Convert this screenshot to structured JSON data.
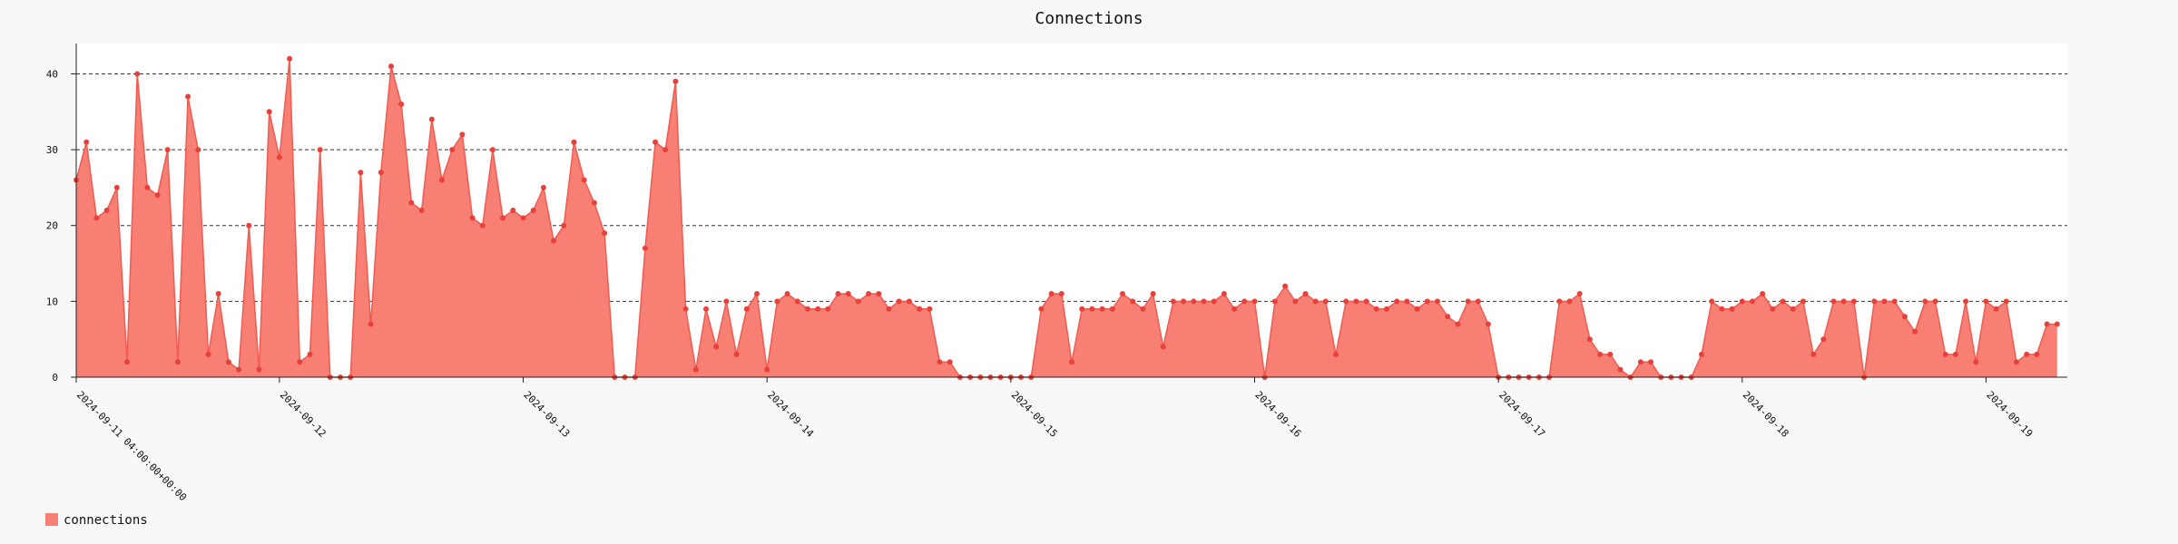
{
  "chart_data": {
    "type": "area",
    "title": "Connections",
    "xlabel": "",
    "ylabel": "",
    "ylim": [
      0,
      44
    ],
    "y_ticks": [
      0,
      10,
      20,
      30,
      40
    ],
    "grid": "horizontal dashed",
    "legend_position": "bottom-left",
    "colors": {
      "fill": "#f77f74",
      "line": "#f15b51",
      "point": "#e8403a",
      "grid": "#333333"
    },
    "x_tick_labels": [
      "2024-09-11 04:00:00+00:00",
      "2024-09-12",
      "2024-09-13",
      "2024-09-14",
      "2024-09-15",
      "2024-09-16",
      "2024-09-17",
      "2024-09-18",
      "2024-09-19"
    ],
    "x_tick_hours": [
      0,
      20,
      44,
      68,
      92,
      116,
      140,
      164,
      188
    ],
    "x_hours_range": [
      0,
      196
    ],
    "series": [
      {
        "name": "connections",
        "x_hours": [
          0,
          1,
          2,
          3,
          4,
          5,
          6,
          7,
          8,
          9,
          10,
          11,
          12,
          13,
          14,
          15,
          16,
          17,
          18,
          19,
          20,
          21,
          22,
          23,
          24,
          25,
          26,
          27,
          28,
          29,
          30,
          31,
          32,
          33,
          34,
          35,
          36,
          37,
          38,
          39,
          40,
          41,
          42,
          43,
          44,
          45,
          46,
          47,
          48,
          49,
          50,
          51,
          52,
          53,
          54,
          55,
          56,
          57,
          58,
          59,
          60,
          61,
          62,
          63,
          64,
          65,
          66,
          67,
          68,
          69,
          70,
          71,
          72,
          73,
          74,
          75,
          76,
          77,
          78,
          79,
          80,
          81,
          82,
          83,
          84,
          85,
          86,
          87,
          88,
          89,
          90,
          91,
          92,
          93,
          94,
          95,
          96,
          97,
          98,
          99,
          100,
          101,
          102,
          103,
          104,
          105,
          106,
          107,
          108,
          109,
          110,
          111,
          112,
          113,
          114,
          115,
          116,
          117,
          118,
          119,
          120,
          121,
          122,
          123,
          124,
          125,
          126,
          127,
          128,
          129,
          130,
          131,
          132,
          133,
          134,
          135,
          136,
          137,
          138,
          139,
          140,
          141,
          142,
          143,
          144,
          145,
          146,
          147,
          148,
          149,
          150,
          151,
          152,
          153,
          154,
          155,
          156,
          157,
          158,
          159,
          160,
          161,
          162,
          163,
          164,
          165,
          166,
          167,
          168,
          169,
          170,
          171,
          172,
          173,
          174,
          175,
          176,
          177,
          178,
          179,
          180,
          181,
          182,
          183,
          184,
          185,
          186,
          187,
          188,
          189,
          190,
          191,
          192,
          193,
          194,
          195,
          196
        ],
        "values": [
          26,
          31,
          21,
          22,
          25,
          2,
          40,
          25,
          24,
          30,
          2,
          37,
          30,
          3,
          11,
          2,
          1,
          20,
          1,
          35,
          29,
          42,
          2,
          3,
          30,
          0,
          0,
          0,
          27,
          7,
          27,
          41,
          36,
          23,
          22,
          34,
          26,
          30,
          32,
          21,
          20,
          30,
          21,
          22,
          21,
          22,
          25,
          18,
          20,
          31,
          26,
          23,
          19,
          0,
          0,
          0,
          17,
          31,
          30,
          39,
          9,
          1,
          9,
          4,
          10,
          3,
          9,
          11,
          1,
          10,
          11,
          10,
          9,
          9,
          9,
          11,
          11,
          10,
          11,
          11,
          9,
          10,
          10,
          9,
          9,
          2,
          2,
          0,
          0,
          0,
          0,
          0,
          0,
          0,
          0,
          9,
          11,
          11,
          2,
          9,
          9,
          9,
          9,
          11,
          10,
          9,
          11,
          4,
          10,
          10,
          10,
          10,
          10,
          11,
          9,
          10,
          10,
          0,
          10,
          12,
          10,
          11,
          10,
          10,
          3,
          10,
          10,
          10,
          9,
          9,
          10,
          10,
          9,
          10,
          10,
          8,
          7,
          10,
          10,
          7,
          0,
          0,
          0,
          0,
          0,
          0,
          10,
          10,
          11,
          5,
          3,
          3,
          1,
          0,
          2,
          2,
          0,
          0,
          0,
          0,
          3,
          10,
          9,
          9,
          10,
          10,
          11,
          9,
          10,
          9,
          10,
          3,
          5,
          10,
          10,
          10,
          0,
          10,
          10,
          10,
          8,
          6,
          10,
          10,
          3,
          3,
          10,
          2,
          10,
          9,
          10,
          2,
          3,
          3,
          7,
          7
        ]
      }
    ]
  }
}
